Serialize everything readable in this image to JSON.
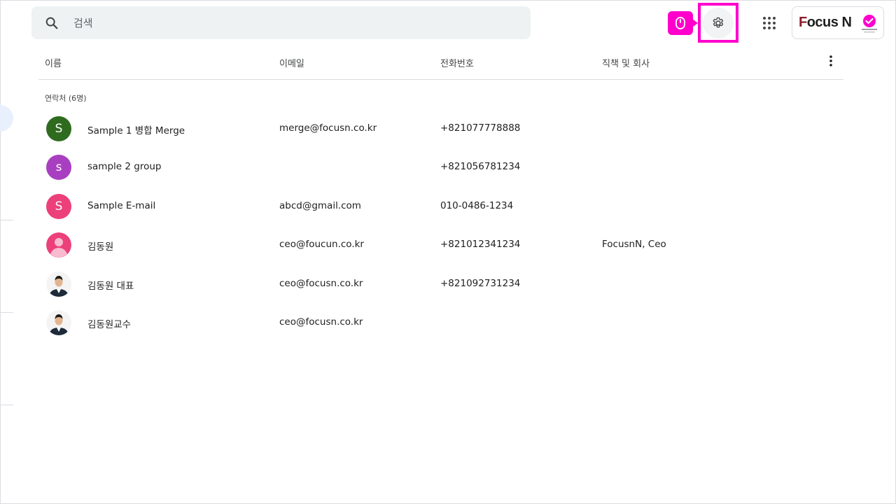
{
  "search": {
    "placeholder": "검색",
    "value": ""
  },
  "header": {
    "brand_text": "Focus N",
    "brand_prefix": "F",
    "brand_rest": "ocus N"
  },
  "colors": {
    "accent_highlight": "#ff00cc",
    "search_bg": "#eef2f3",
    "divider": "#dadce0"
  },
  "table": {
    "columns": {
      "name": "이름",
      "email": "이메일",
      "phone": "전화번호",
      "title": "직책 및 회사"
    },
    "section_label": "연락처 (6명)",
    "rows": [
      {
        "initial": "S",
        "color": "#2e6b1f",
        "avatar_type": "letter",
        "name": "Sample 1 병합 Merge",
        "email": "merge@focusn.co.kr",
        "phone": "+821077778888",
        "title": ""
      },
      {
        "initial": "s",
        "color": "#a83fc0",
        "avatar_type": "letter",
        "name": "sample 2 group",
        "email": "",
        "phone": "+821056781234",
        "title": ""
      },
      {
        "initial": "S",
        "color": "#ec407a",
        "avatar_type": "letter",
        "name": "Sample E-mail",
        "email": "abcd@gmail.com",
        "phone": "010-0486-1234",
        "title": ""
      },
      {
        "initial": "",
        "color": "#ec407a",
        "avatar_type": "person",
        "name": "김동원",
        "email": "ceo@foucun.co.kr",
        "phone": "+821012341234",
        "title": "FocusnN, Ceo"
      },
      {
        "initial": "",
        "color": "#ffffff",
        "avatar_type": "photo",
        "name": "김동원 대표",
        "email": "ceo@focusn.co.kr",
        "phone": "+821092731234",
        "title": ""
      },
      {
        "initial": "",
        "color": "#ffffff",
        "avatar_type": "photo",
        "name": "김동원교수",
        "email": "ceo@focusn.co.kr",
        "phone": "",
        "title": ""
      }
    ]
  }
}
